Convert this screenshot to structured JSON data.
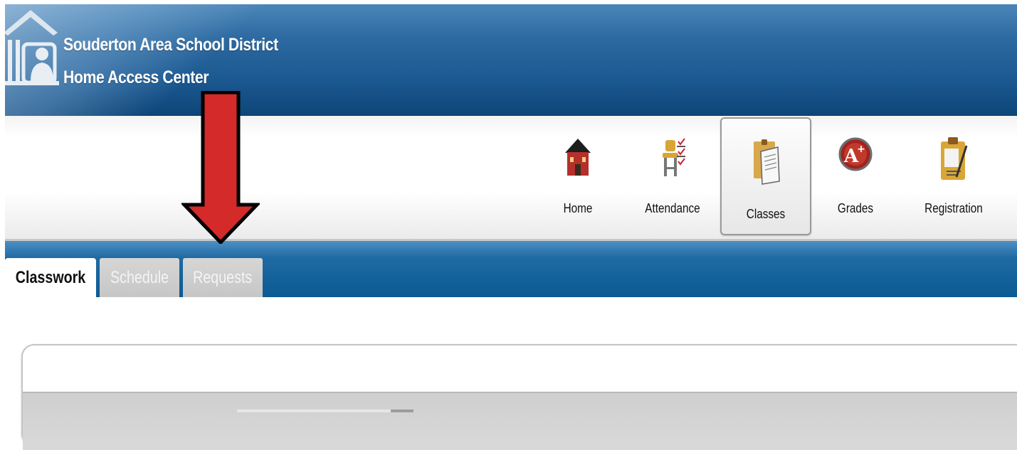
{
  "header": {
    "district_name": "Souderton Area School District",
    "app_name": "Home Access Center",
    "logo_icon": "school-building-logo-icon"
  },
  "nav": {
    "items": [
      {
        "label": "Home",
        "icon": "schoolhouse-icon",
        "active": false
      },
      {
        "label": "Attendance",
        "icon": "attendance-checklist-icon",
        "active": false
      },
      {
        "label": "Classes",
        "icon": "classes-folder-icon",
        "active": true
      },
      {
        "label": "Grades",
        "icon": "grades-aplus-icon",
        "active": false
      },
      {
        "label": "Registration",
        "icon": "registration-clipboard-icon",
        "active": false
      }
    ]
  },
  "tabs": [
    {
      "label": "Classwork",
      "active": true
    },
    {
      "label": "Schedule",
      "active": false
    },
    {
      "label": "Requests",
      "active": false
    }
  ],
  "annotation": {
    "icon": "red-down-arrow-icon",
    "color": "#d42a2a"
  },
  "colors": {
    "header_blue": "#1a5790",
    "tab_bar_blue": "#0b5a93",
    "arrow_red": "#d42a2a"
  }
}
